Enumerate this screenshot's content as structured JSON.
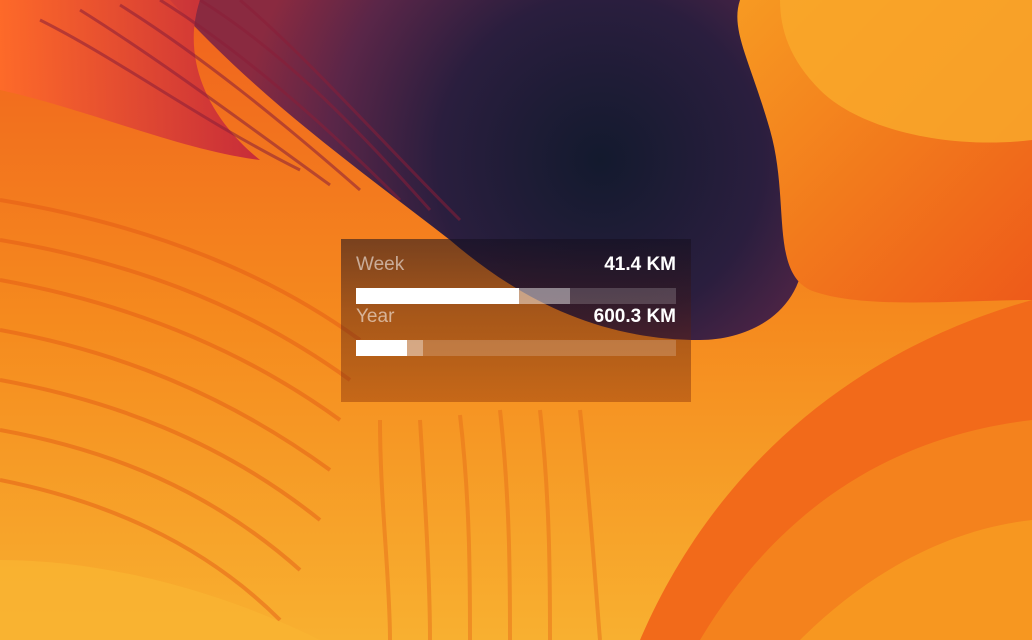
{
  "widget": {
    "week": {
      "label": "Week",
      "value": "41.4 KM",
      "progress_fraction": 0.51,
      "secondary_fraction": 0.67
    },
    "year": {
      "label": "Year",
      "value": "600.3 KM",
      "progress_fraction": 0.16,
      "secondary_fraction": 0.21
    }
  },
  "colors": {
    "accent_fill": "#ffffff",
    "wallpaper_orange": "#f08a1c",
    "wallpaper_dark": "#1a1e33"
  }
}
